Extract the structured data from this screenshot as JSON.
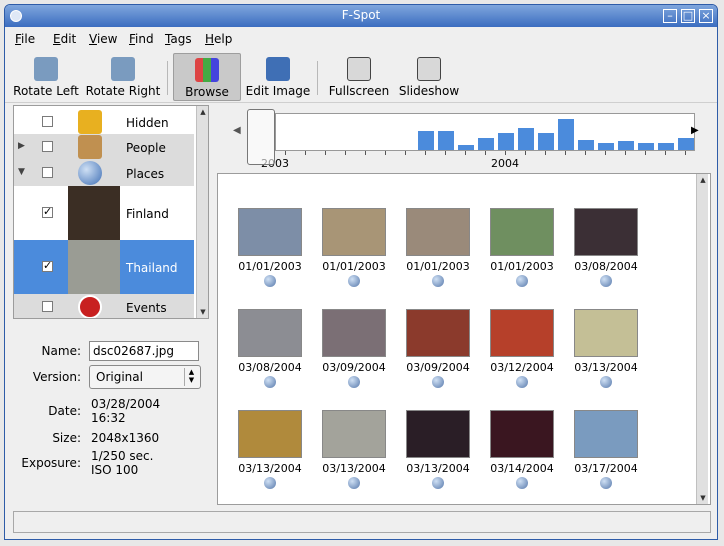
{
  "window": {
    "title": "F-Spot"
  },
  "menu": [
    {
      "label": "File",
      "mnemonic": "F",
      "rest": "ile"
    },
    {
      "label": "Edit",
      "mnemonic": "E",
      "rest": "dit"
    },
    {
      "label": "View",
      "mnemonic": "V",
      "rest": "iew"
    },
    {
      "label": "Find",
      "mnemonic": "F",
      "rest": "ind"
    },
    {
      "label": "Tags",
      "mnemonic": "T",
      "rest": "ags"
    },
    {
      "label": "Help",
      "mnemonic": "H",
      "rest": "elp"
    }
  ],
  "toolbar": {
    "rotate_left": "Rotate Left",
    "rotate_right": "Rotate Right",
    "browse": "Browse",
    "edit_image": "Edit Image",
    "fullscreen": "Fullscreen",
    "slideshow": "Slideshow"
  },
  "tags": [
    {
      "label": "Hidden",
      "checked": false,
      "icon": "lock-icon"
    },
    {
      "label": "People",
      "checked": false,
      "icon": "people-icon",
      "expander": "collapsed"
    },
    {
      "label": "Places",
      "checked": false,
      "icon": "globe-icon",
      "expander": "expanded"
    },
    {
      "label": "Finland",
      "checked": true,
      "icon": "thumbnail"
    },
    {
      "label": "Thailand",
      "checked": true,
      "icon": "thumbnail",
      "selected": true
    },
    {
      "label": "Events",
      "checked": false,
      "icon": "clock-icon"
    }
  ],
  "info": {
    "name_label": "Name:",
    "name_value": "dsc02687.jpg",
    "version_label": "Version:",
    "version_value": "Original",
    "date_label": "Date:",
    "date_value": "03/28/2004",
    "time_value": "16:32",
    "size_label": "Size:",
    "size_value": "2048x1360",
    "exposure_label": "Exposure:",
    "exposure_value": "1/250 sec.",
    "iso_value": "ISO 100"
  },
  "timeline": {
    "year_left": "2003",
    "year_right": "2004",
    "bar_levels": [
      0,
      0,
      0,
      0,
      0,
      0,
      0,
      0.55,
      0.55,
      0.15,
      0.35,
      0.5,
      0.65,
      0.5,
      0.9,
      0.3,
      0.2,
      0.25,
      0.2,
      0.2,
      0.35
    ]
  },
  "photos": [
    {
      "date": "01/01/2003",
      "color": "#7d8ea7"
    },
    {
      "date": "01/01/2003",
      "color": "#a89576"
    },
    {
      "date": "01/01/2003",
      "color": "#9a8a7a"
    },
    {
      "date": "01/01/2003",
      "color": "#6f8f60"
    },
    {
      "date": "03/08/2004",
      "color": "#3b2f35"
    },
    {
      "date": "03/08/2004",
      "color": "#8c8d93"
    },
    {
      "date": "03/09/2004",
      "color": "#7b6f75"
    },
    {
      "date": "03/09/2004",
      "color": "#8b3a2c"
    },
    {
      "date": "03/12/2004",
      "color": "#b6402a"
    },
    {
      "date": "03/13/2004",
      "color": "#c4bf96"
    },
    {
      "date": "03/13/2004",
      "color": "#b08a3c"
    },
    {
      "date": "03/13/2004",
      "color": "#a3a39b"
    },
    {
      "date": "03/13/2004",
      "color": "#2a1e26"
    },
    {
      "date": "03/14/2004",
      "color": "#3a1620"
    },
    {
      "date": "03/17/2004",
      "color": "#7a9bbf"
    }
  ],
  "colors": {
    "title_bar": "#3b6dc0",
    "selection": "#4b8bdc",
    "timeline_bar": "#4b8bdc"
  }
}
